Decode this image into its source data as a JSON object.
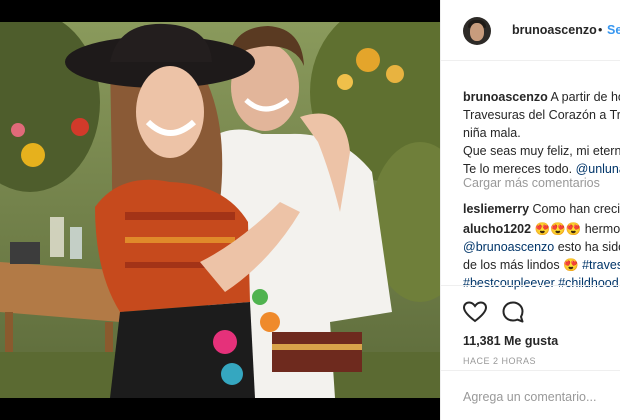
{
  "post": {
    "author": "brunoascenzo",
    "follow_label": "Seguir",
    "separator": "•",
    "caption": {
      "author": "brunoascenzo",
      "line1_text": " A partir de hoy",
      "line2_text": "Travesuras del Corazón a Travesuras del",
      "line3_text": "niña mala.",
      "line4_text": "Que seas muy feliz, mi eterna travesura.",
      "line5_text": "Te lo mereces todo. ",
      "line5_mention": "@unlunar"
    },
    "load_more_label": "Cargar más comentarios",
    "comments": [
      {
        "user": "lesliemerry",
        "text": " Como han crecido"
      },
      {
        "user": "alucho1202",
        "text": " 😍😍😍 hermosos"
      },
      {
        "user": "",
        "mention": "@brunoascenzo",
        "text": " esto ha sido"
      },
      {
        "user": "",
        "text": "de los más lindos 😍 ",
        "tag": "#travesuras"
      },
      {
        "user": "",
        "tag": "#bestcoupleever #childhood"
      }
    ],
    "likes_label": "11,381 Me gusta",
    "time_label": "HACE 2 HORAS",
    "add_comment_placeholder": "Agrega un comentario..."
  },
  "colors": {
    "link": "#3897f0",
    "mention": "#003569",
    "muted": "#999999",
    "text": "#262626"
  },
  "icons": [
    "heart-icon",
    "comment-icon"
  ]
}
